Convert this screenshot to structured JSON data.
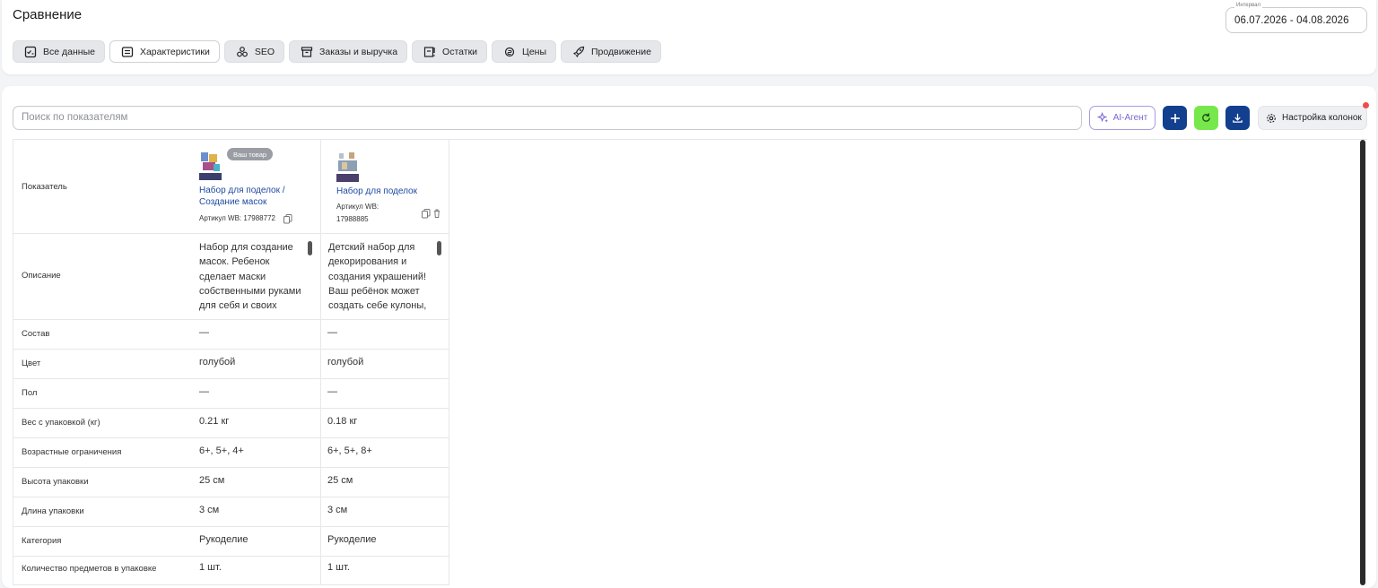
{
  "header": {
    "title": "Сравнение",
    "interval_label": "Интервал",
    "interval_value": "06.07.2026 - 04.08.2026"
  },
  "tabs": [
    {
      "label": "Все данные",
      "icon": "checklist-icon",
      "active": false
    },
    {
      "label": "Характеристики",
      "icon": "card-icon",
      "active": true
    },
    {
      "label": "SEO",
      "icon": "seo-icon",
      "active": false
    },
    {
      "label": "Заказы и выручка",
      "icon": "box-icon",
      "active": false
    },
    {
      "label": "Остатки",
      "icon": "stock-icon",
      "active": false
    },
    {
      "label": "Цены",
      "icon": "coins-icon",
      "active": false
    },
    {
      "label": "Продвижение",
      "icon": "rocket-icon",
      "active": false
    }
  ],
  "toolbar": {
    "search_placeholder": "Поиск по показателям",
    "ai_label": "AI-Агент",
    "columns_label": "Настройка колонок"
  },
  "table": {
    "header_label": "Показатель",
    "products": [
      {
        "badge": "Ваш товар",
        "name": "Набор для поделок / Создание масок",
        "sku": "Артикул WB: 17988772",
        "description": "Набор для создание масок. Ребенок сделает маски собственными руками для себя и своих"
      },
      {
        "badge": "",
        "name": "Набор для поделок",
        "sku": "Артикул WB: 17988885",
        "description": "Детский набор для декорирования и создания украшений! Ваш ребёнок может создать себе кулоны,"
      }
    ],
    "rows": [
      {
        "label": "Описание",
        "values": [
          "",
          ""
        ]
      },
      {
        "label": "Состав",
        "values": [
          "—",
          "—"
        ]
      },
      {
        "label": "Цвет",
        "values": [
          "голубой",
          "голубой"
        ]
      },
      {
        "label": "Пол",
        "values": [
          "—",
          "—"
        ]
      },
      {
        "label": "Вес с упаковкой (кг)",
        "values": [
          "0.21 кг",
          "0.18 кг"
        ]
      },
      {
        "label": "Возрастные ограничения",
        "values": [
          "6+, 5+, 4+",
          "6+, 5+, 8+"
        ]
      },
      {
        "label": "Высота упаковки",
        "values": [
          "25 см",
          "25 см"
        ]
      },
      {
        "label": "Длина упаковки",
        "values": [
          "3 см",
          "3 см"
        ]
      },
      {
        "label": "Категория",
        "values": [
          "Рукоделие",
          "Рукоделие"
        ]
      },
      {
        "label": "Количество предметов в упаковке",
        "values": [
          "1 шт.",
          "1 шт."
        ]
      }
    ]
  }
}
